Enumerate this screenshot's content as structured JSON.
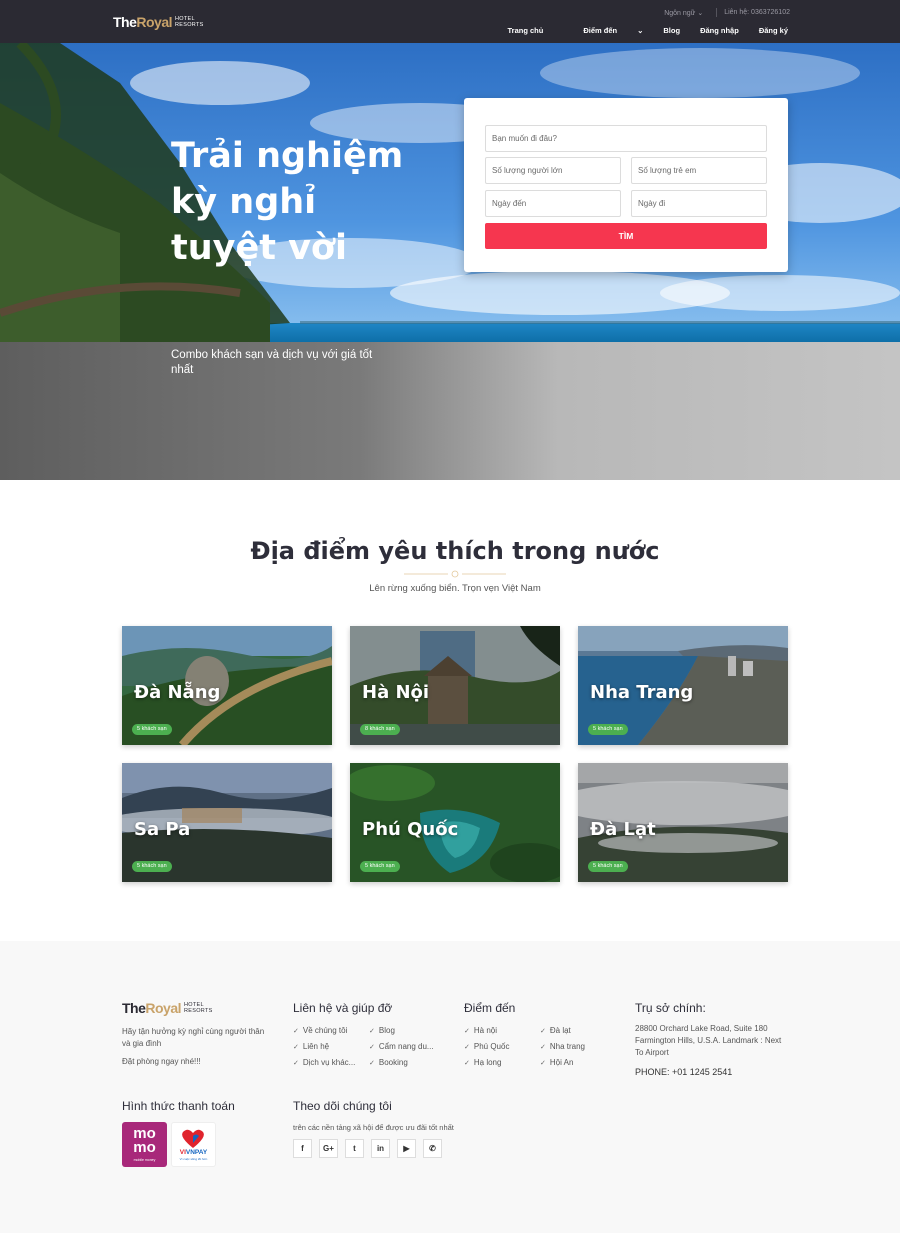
{
  "header": {
    "logo": {
      "the": "The",
      "royal": "Royal",
      "hotel": "HOTEL",
      "resorts": "RESORTS"
    },
    "language": "Ngôn ngữ",
    "contact": "Liên hệ: 0363726102",
    "nav": [
      "Trang chủ",
      "Điểm đến",
      "Blog",
      "Đăng nhập",
      "Đăng ký"
    ]
  },
  "hero": {
    "title": "Trải nghiệm kỳ nghỉ tuyệt vời",
    "subtitle": "Combo khách sạn và dịch vụ với giá tốt nhất"
  },
  "search": {
    "destination_placeholder": "Bạn muốn đi đâu?",
    "adults_placeholder": "Số lượng người lớn",
    "children_placeholder": "Số lượng trẻ em",
    "checkin_placeholder": "Ngày đến",
    "checkout_placeholder": "Ngày đi",
    "button": "TÌM",
    "button_color": "#f6364f"
  },
  "section": {
    "title": "Địa điểm yêu thích trong nước",
    "subtitle": "Lên rừng xuống biển. Trọn vẹn Việt Nam",
    "destinations": [
      {
        "city": "Đà Nẵng",
        "badge": "5 khách sạn"
      },
      {
        "city": "Hà Nội",
        "badge": "8 khách sạn"
      },
      {
        "city": "Nha Trang",
        "badge": "5 khách sạn"
      },
      {
        "city": "Sa Pa",
        "badge": "5 khách sạn"
      },
      {
        "city": "Phú Quốc",
        "badge": "5 khách sạn"
      },
      {
        "city": "Đà Lạt",
        "badge": "5 khách sạn"
      }
    ]
  },
  "footer": {
    "about_line1": "Hãy tận hưởng kỳ nghỉ cùng người thân và gia đình",
    "about_line2": "Đặt phòng ngay nhé!!!",
    "help_title": "Liên hệ và giúp đỡ",
    "help_col1": [
      "Về chúng tôi",
      "Liên hệ",
      "Dịch vụ khác..."
    ],
    "help_col2": [
      "Blog",
      "Cẩm nang du...",
      "Booking"
    ],
    "dest_title": "Điểm đến",
    "dest_col1": [
      "Hà nội",
      "Phú Quốc",
      "Hạ long"
    ],
    "dest_col2": [
      "Đà lạt",
      "Nha trang",
      "Hội An"
    ],
    "office_title": "Trụ sở chính:",
    "office_address": "28800 Orchard Lake Road, Suite 180 Farmington Hills, U.S.A. Landmark : Next To Airport",
    "office_phone": "PHONE: +01 1245 2541",
    "payment_title": "Hình thức thanh toán",
    "momo_top": "mo",
    "momo_bottom": "mo",
    "momo_tag": "mobile money",
    "vnpay_label": "VNPAY",
    "vnpay_vi": "VI",
    "vnpay_tag": "Vì cuộc sống tốt hơn",
    "follow_title": "Theo dõi chúng tôi",
    "follow_text": "trên các nền tảng xã hội để được ưu đãi tốt nhất",
    "social_icons": [
      {
        "icon": "facebook-icon",
        "glyph": "f"
      },
      {
        "icon": "google-plus-icon",
        "glyph": "G+"
      },
      {
        "icon": "twitter-icon",
        "glyph": "t"
      },
      {
        "icon": "linkedin-icon",
        "glyph": "in"
      },
      {
        "icon": "youtube-icon",
        "glyph": "▶"
      },
      {
        "icon": "whatsapp-icon",
        "glyph": "✆"
      }
    ]
  }
}
